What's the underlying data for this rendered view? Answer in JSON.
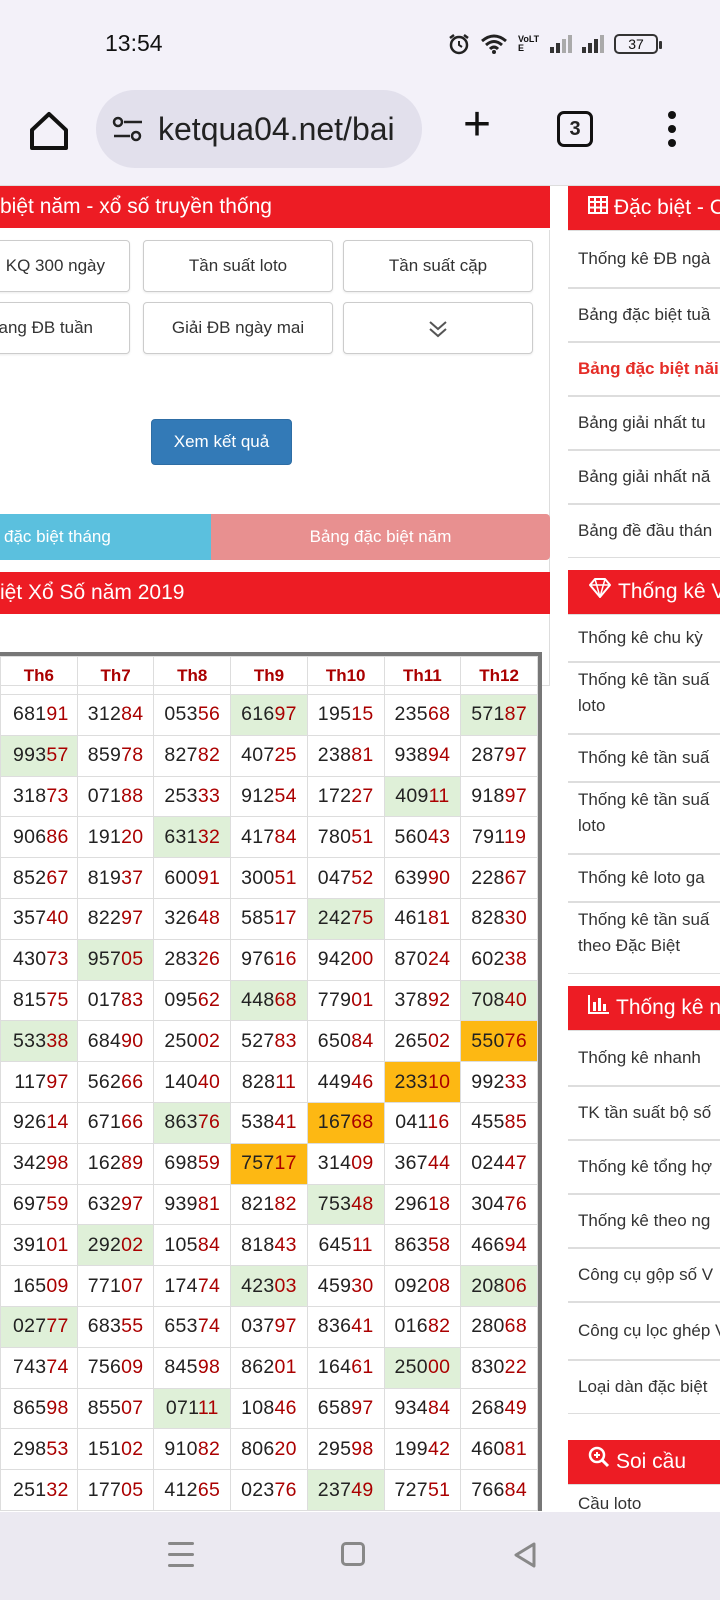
{
  "status": {
    "time": "13:54",
    "battery": "37",
    "volte": "VoLTE"
  },
  "browser": {
    "url": "ketqua04.net/bai",
    "tabs_count": "3"
  },
  "main": {
    "header_title": "biệt năm - xổ số truyền thống",
    "buttons": [
      "KQ 300 ngày",
      "Tần suất loto",
      "Tần suất cặp",
      "ang ĐB tuần",
      "Giải ĐB ngày mai"
    ],
    "view_button": "Xem kết quả",
    "tab_month": "đặc biệt tháng",
    "tab_year": "Bảng đặc biệt năm",
    "table_title": "iệt Xổ Số năm 2019"
  },
  "table": {
    "headers": [
      "Th6",
      "Th7",
      "Th8",
      "Th9",
      "Th10",
      "Th11",
      "Th12"
    ],
    "rows": [
      [
        [
          "681",
          "91",
          ""
        ],
        [
          "312",
          "84",
          ""
        ],
        [
          "053",
          "56",
          ""
        ],
        [
          "616",
          "97",
          "g"
        ],
        [
          "195",
          "15",
          ""
        ],
        [
          "235",
          "68",
          ""
        ],
        [
          "571",
          "87",
          "g"
        ]
      ],
      [
        [
          "993",
          "57",
          "g"
        ],
        [
          "859",
          "78",
          ""
        ],
        [
          "827",
          "82",
          ""
        ],
        [
          "407",
          "25",
          ""
        ],
        [
          "238",
          "81",
          ""
        ],
        [
          "938",
          "94",
          ""
        ],
        [
          "287",
          "97",
          ""
        ]
      ],
      [
        [
          "318",
          "73",
          ""
        ],
        [
          "071",
          "88",
          ""
        ],
        [
          "253",
          "33",
          ""
        ],
        [
          "912",
          "54",
          ""
        ],
        [
          "172",
          "27",
          ""
        ],
        [
          "409",
          "11",
          "g"
        ],
        [
          "918",
          "97",
          ""
        ]
      ],
      [
        [
          "906",
          "86",
          ""
        ],
        [
          "191",
          "20",
          ""
        ],
        [
          "631",
          "32",
          "g"
        ],
        [
          "417",
          "84",
          ""
        ],
        [
          "780",
          "51",
          ""
        ],
        [
          "560",
          "43",
          ""
        ],
        [
          "791",
          "19",
          ""
        ]
      ],
      [
        [
          "852",
          "67",
          ""
        ],
        [
          "819",
          "37",
          ""
        ],
        [
          "600",
          "91",
          ""
        ],
        [
          "300",
          "51",
          ""
        ],
        [
          "047",
          "52",
          ""
        ],
        [
          "639",
          "90",
          ""
        ],
        [
          "228",
          "67",
          ""
        ]
      ],
      [
        [
          "357",
          "40",
          ""
        ],
        [
          "822",
          "97",
          ""
        ],
        [
          "326",
          "48",
          ""
        ],
        [
          "585",
          "17",
          ""
        ],
        [
          "242",
          "75",
          "g"
        ],
        [
          "461",
          "81",
          ""
        ],
        [
          "828",
          "30",
          ""
        ]
      ],
      [
        [
          "430",
          "73",
          ""
        ],
        [
          "957",
          "05",
          "g"
        ],
        [
          "283",
          "26",
          ""
        ],
        [
          "976",
          "16",
          ""
        ],
        [
          "942",
          "00",
          ""
        ],
        [
          "870",
          "24",
          ""
        ],
        [
          "602",
          "38",
          ""
        ]
      ],
      [
        [
          "815",
          "75",
          ""
        ],
        [
          "017",
          "83",
          ""
        ],
        [
          "095",
          "62",
          ""
        ],
        [
          "448",
          "68",
          "g"
        ],
        [
          "779",
          "01",
          ""
        ],
        [
          "378",
          "92",
          ""
        ],
        [
          "708",
          "40",
          "g"
        ]
      ],
      [
        [
          "533",
          "38",
          "g"
        ],
        [
          "684",
          "90",
          ""
        ],
        [
          "250",
          "02",
          ""
        ],
        [
          "527",
          "83",
          ""
        ],
        [
          "650",
          "84",
          ""
        ],
        [
          "265",
          "02",
          ""
        ],
        [
          "550",
          "76",
          "o"
        ]
      ],
      [
        [
          "117",
          "97",
          ""
        ],
        [
          "562",
          "66",
          ""
        ],
        [
          "140",
          "40",
          ""
        ],
        [
          "828",
          "11",
          ""
        ],
        [
          "449",
          "46",
          ""
        ],
        [
          "233",
          "10",
          "o"
        ],
        [
          "992",
          "33",
          ""
        ]
      ],
      [
        [
          "926",
          "14",
          ""
        ],
        [
          "671",
          "66",
          ""
        ],
        [
          "863",
          "76",
          "g"
        ],
        [
          "538",
          "41",
          ""
        ],
        [
          "167",
          "68",
          "o"
        ],
        [
          "041",
          "16",
          ""
        ],
        [
          "455",
          "85",
          ""
        ]
      ],
      [
        [
          "342",
          "98",
          ""
        ],
        [
          "162",
          "89",
          ""
        ],
        [
          "698",
          "59",
          ""
        ],
        [
          "757",
          "17",
          "o"
        ],
        [
          "314",
          "09",
          ""
        ],
        [
          "367",
          "44",
          ""
        ],
        [
          "024",
          "47",
          ""
        ]
      ],
      [
        [
          "697",
          "59",
          ""
        ],
        [
          "632",
          "97",
          ""
        ],
        [
          "939",
          "81",
          ""
        ],
        [
          "821",
          "82",
          ""
        ],
        [
          "753",
          "48",
          "g"
        ],
        [
          "296",
          "18",
          ""
        ],
        [
          "304",
          "76",
          ""
        ]
      ],
      [
        [
          "391",
          "01",
          ""
        ],
        [
          "292",
          "02",
          "g"
        ],
        [
          "105",
          "84",
          ""
        ],
        [
          "818",
          "43",
          ""
        ],
        [
          "645",
          "11",
          ""
        ],
        [
          "863",
          "58",
          ""
        ],
        [
          "466",
          "94",
          ""
        ]
      ],
      [
        [
          "165",
          "09",
          ""
        ],
        [
          "771",
          "07",
          ""
        ],
        [
          "174",
          "74",
          ""
        ],
        [
          "423",
          "03",
          "g"
        ],
        [
          "459",
          "30",
          ""
        ],
        [
          "092",
          "08",
          ""
        ],
        [
          "208",
          "06",
          "g"
        ]
      ],
      [
        [
          "027",
          "77",
          "g"
        ],
        [
          "683",
          "55",
          ""
        ],
        [
          "653",
          "74",
          ""
        ],
        [
          "037",
          "97",
          ""
        ],
        [
          "836",
          "41",
          ""
        ],
        [
          "016",
          "82",
          ""
        ],
        [
          "280",
          "68",
          ""
        ]
      ],
      [
        [
          "743",
          "74",
          ""
        ],
        [
          "756",
          "09",
          ""
        ],
        [
          "845",
          "98",
          ""
        ],
        [
          "862",
          "01",
          ""
        ],
        [
          "164",
          "61",
          ""
        ],
        [
          "250",
          "00",
          "g"
        ],
        [
          "830",
          "22",
          ""
        ]
      ],
      [
        [
          "865",
          "98",
          ""
        ],
        [
          "855",
          "07",
          ""
        ],
        [
          "071",
          "11",
          "g"
        ],
        [
          "108",
          "46",
          ""
        ],
        [
          "658",
          "97",
          ""
        ],
        [
          "934",
          "84",
          ""
        ],
        [
          "268",
          "49",
          ""
        ]
      ],
      [
        [
          "298",
          "53",
          ""
        ],
        [
          "151",
          "02",
          ""
        ],
        [
          "910",
          "82",
          ""
        ],
        [
          "806",
          "20",
          ""
        ],
        [
          "295",
          "98",
          ""
        ],
        [
          "199",
          "42",
          ""
        ],
        [
          "460",
          "81",
          ""
        ]
      ],
      [
        [
          "251",
          "32",
          ""
        ],
        [
          "177",
          "05",
          ""
        ],
        [
          "412",
          "65",
          ""
        ],
        [
          "023",
          "76",
          ""
        ],
        [
          "237",
          "49",
          "g"
        ],
        [
          "727",
          "51",
          ""
        ],
        [
          "766",
          "84",
          ""
        ]
      ]
    ]
  },
  "sidebar": {
    "sections": [
      {
        "title": "Đặc biệt - C",
        "icon": "table-icon",
        "items": [
          "Thống kê ĐB ngà",
          "Bảng đặc biệt tuầ",
          "Bảng đặc biệt năi",
          "Bảng giải nhất tu",
          "Bảng giải nhất nă",
          "Bảng đề đầu thán"
        ]
      },
      {
        "title": "Thống kê V",
        "icon": "diamond-icon",
        "items": [
          "Thống kê chu kỳ",
          "Thống kê tần suấ loto",
          "Thống kê tần suấ",
          "Thống kê tần suấ loto",
          "Thống kê loto ga",
          "Thống kê tần suấ theo Đặc Biệt"
        ]
      },
      {
        "title": "Thống kê n",
        "icon": "bar-chart-icon",
        "items": [
          "Thống kê nhanh",
          "TK tần suất bộ số",
          "Thống kê tổng hợ",
          "Thống kê theo ng",
          "Công cụ gộp số V",
          "Công cụ lọc ghép VIP",
          "Loại dàn đặc biệt"
        ]
      },
      {
        "title": "Soi cầu",
        "icon": "search-plus-icon",
        "items": [
          "Cầu loto"
        ]
      }
    ]
  },
  "colors": {
    "red": "#ed1c24",
    "blue": "#337ab7",
    "cyan": "#5bc0de",
    "pink": "#e89090",
    "green_cell": "#dff0d8",
    "orange_cell": "#fdb813"
  }
}
